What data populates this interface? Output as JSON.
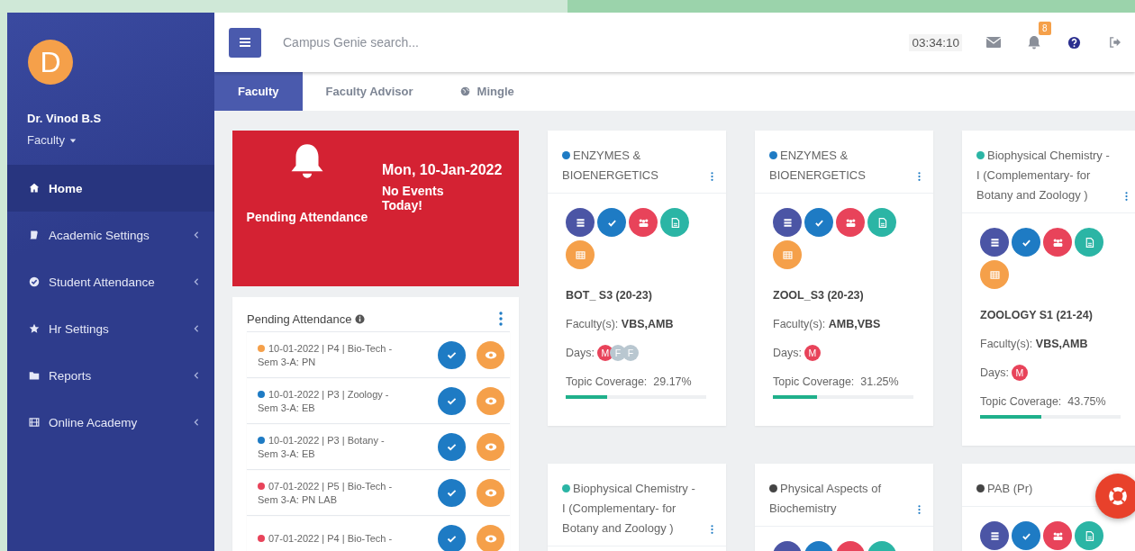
{
  "user": {
    "initial": "D",
    "name": "Dr. Vinod B.S",
    "role": "Faculty"
  },
  "sidebar": {
    "items": [
      {
        "label": "Home",
        "selected": true,
        "expandable": false
      },
      {
        "label": "Academic Settings",
        "selected": false,
        "expandable": true
      },
      {
        "label": "Student Attendance",
        "selected": false,
        "expandable": true
      },
      {
        "label": "Hr Settings",
        "selected": false,
        "expandable": true
      },
      {
        "label": "Reports",
        "selected": false,
        "expandable": true
      },
      {
        "label": "Online Academy",
        "selected": false,
        "expandable": true
      }
    ]
  },
  "topbar": {
    "search": {
      "placeholder": "Campus Genie search..."
    },
    "time": "03:34:10",
    "notification_count": "8"
  },
  "tabs": [
    {
      "label": "Faculty",
      "selected": true
    },
    {
      "label": "Faculty Advisor",
      "selected": false
    },
    {
      "label": "Mingle",
      "selected": false
    }
  ],
  "reminder": {
    "title": "Pending Attendance",
    "date": "Mon, 10-Jan-2022",
    "events": "No Events Today!"
  },
  "pending": {
    "title": "Pending Attendance",
    "items": [
      {
        "line1": "10-01-2022 | P4 | Bio-Tech -",
        "line2": "Sem 3-A: PN",
        "color": "#f5a04a"
      },
      {
        "line1": "10-01-2022 | P3 | Zoology -",
        "line2": "Sem 3-A: EB",
        "color": "#1e7bc4"
      },
      {
        "line1": "10-01-2022 | P3 | Botany -",
        "line2": "Sem 3-A: EB",
        "color": "#1e7bc4"
      },
      {
        "line1": "07-01-2022 | P5 | Bio-Tech -",
        "line2": "Sem 3-A: PN LAB",
        "color": "#e8435a"
      },
      {
        "line1": "07-01-2022 | P4 | Bio-Tech -",
        "color": "#e8435a"
      }
    ]
  },
  "courses": [
    {
      "title": "ENZYMES & BIOENERGETICS",
      "color": "#1e7bc4",
      "batch": "BOT_ S3 (20-23)",
      "faculty": "Faculty(s): **VBS,AMB**",
      "days_label": "Days:",
      "days": [
        {
          "letter": "M",
          "color": "#e8435a"
        },
        {
          "letter": "F",
          "color": "#b9c7d0"
        },
        {
          "letter": "F",
          "color": "#b9c7d0"
        }
      ],
      "coverage": "Topic Coverage:  29.17%",
      "level": 0.2917
    },
    {
      "title": "ENZYMES & BIOENERGETICS",
      "color": "#1e7bc4",
      "batch": "ZOOL_S3 (20-23)",
      "faculty": "Faculty(s): **AMB,VBS**",
      "days_label": "Days:",
      "days": [
        {
          "letter": "M",
          "color": "#e8435a"
        }
      ],
      "coverage": "Topic Coverage:  31.25%",
      "level": 0.3125
    },
    {
      "title": "Biophysical Chemistry - I (Complementary- for Botany and Zoology )",
      "color": "#2bb5a5",
      "batch": "ZOOLOGY S1 (21-24)",
      "faculty": "Faculty(s): **VBS,AMB**",
      "days_label": "Days:",
      "days": [
        {
          "letter": "M",
          "color": "#e8435a"
        }
      ],
      "coverage": "Topic Coverage:  43.75%",
      "level": 0.4375
    },
    {
      "title": "Biophysical Chemistry - I (Complementary- for Botany and Zoology )",
      "color": "#2bb5a5"
    },
    {
      "title": "Physical Aspects of Biochemistry",
      "color": "#444444"
    },
    {
      "title": "PAB (Pr)",
      "color": "#444444"
    }
  ]
}
